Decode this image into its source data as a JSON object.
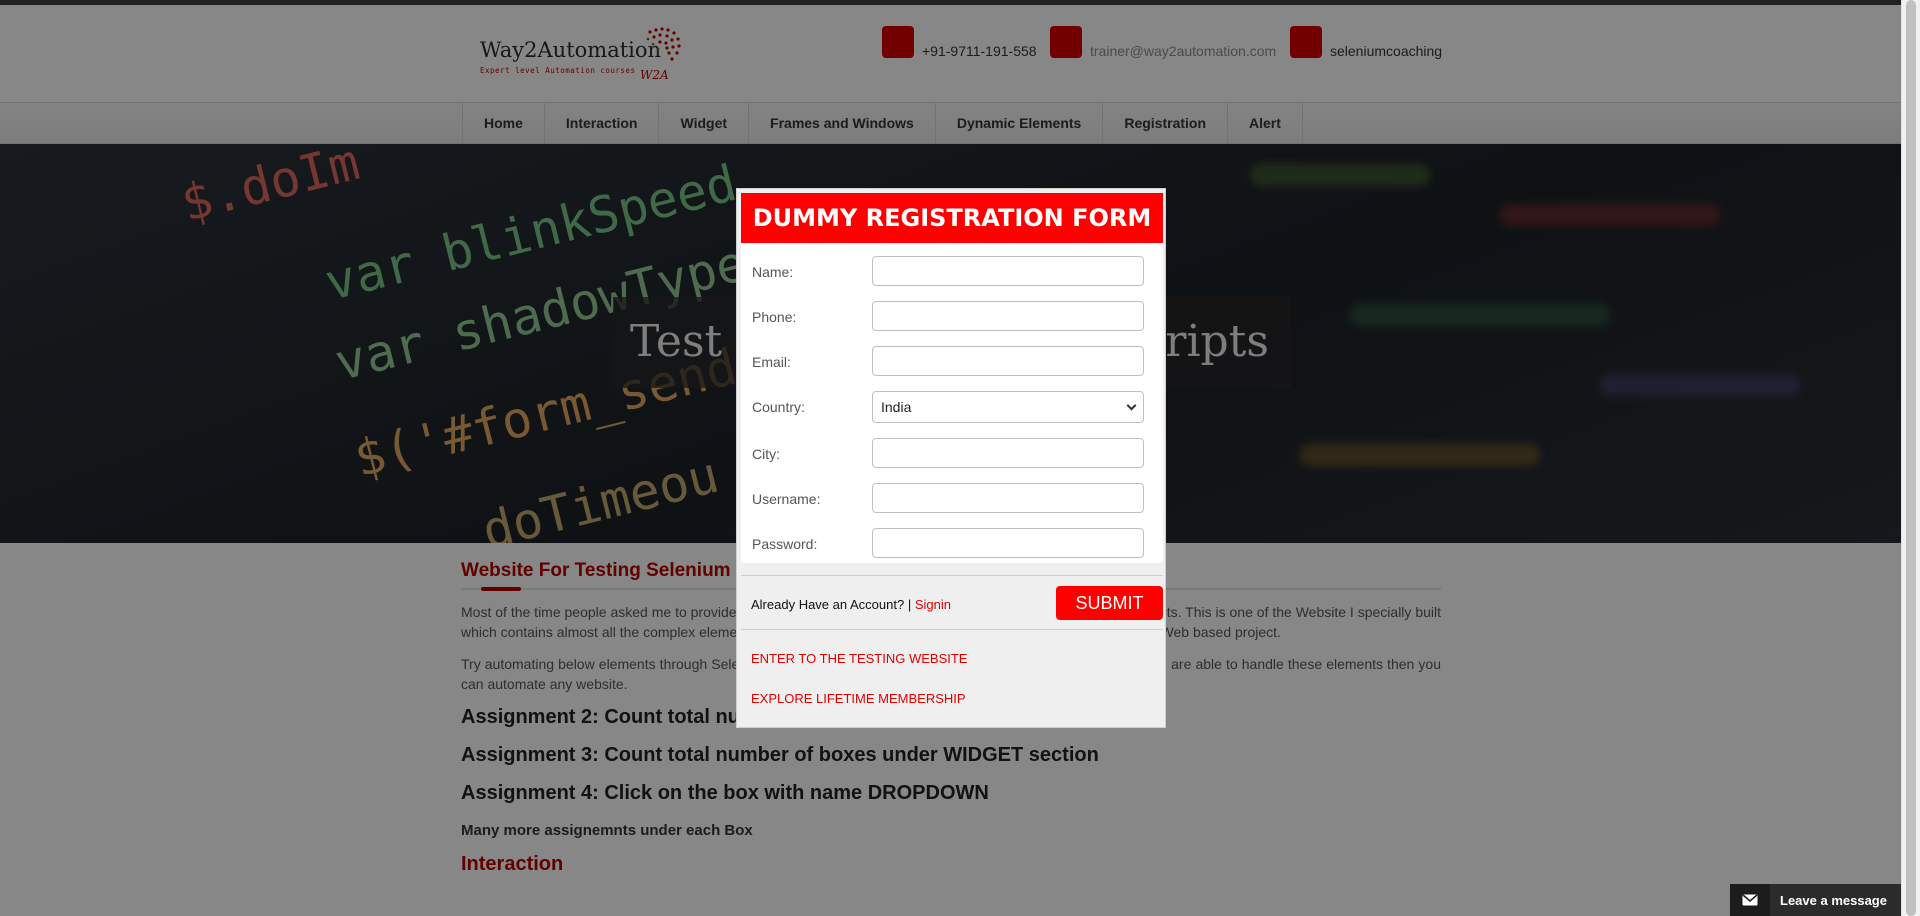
{
  "brand": {
    "name": "Way2Automation",
    "tagline": "Expert level Automation courses",
    "mark": "W2A"
  },
  "contacts": [
    {
      "icon": "phone-icon",
      "text": "+91-9711-191-558"
    },
    {
      "icon": "email-icon",
      "text": "trainer@way2automation.com"
    },
    {
      "icon": "skype-icon",
      "text": "seleniumcoaching"
    }
  ],
  "nav": [
    "Home",
    "Interaction",
    "Widget",
    "Frames and Windows",
    "Dynamic Elements",
    "Registration",
    "Alert"
  ],
  "hero": {
    "tagline": "Test your automation scripts",
    "code_lines": [
      "$.doIm",
      "var blinkSpeed",
      "var shadowType",
      "$('#form_send",
      "doTimeou"
    ]
  },
  "content": {
    "heading": "Website For Testing Selenium Scripts",
    "para1": "Most of the time people asked me to provide a website which they can use to practice their Selenium or QTP scripts. This is one of the Website I specially built which contains almost all the complex elements which we come across mostly while performing Automation on a Web based project.",
    "para2": "Try automating below elements through Selenium and you will be confident in executing automation scripts. If you are able to handle these elements then you can automate any website.",
    "assignments": [
      "Assignment 2: Count total number of boxes from below page",
      "Assignment 3: Count total number of boxes under WIDGET section",
      "Assignment 4: Click on the box with name DROPDOWN"
    ],
    "more": "Many more assignemnts under each Box",
    "section": "Interaction"
  },
  "modal": {
    "title": "DUMMY REGISTRATION FORM",
    "fields": {
      "name": {
        "label": "Name:",
        "value": ""
      },
      "phone": {
        "label": "Phone:",
        "value": ""
      },
      "email": {
        "label": "Email:",
        "value": ""
      },
      "country": {
        "label": "Country:",
        "value": "India"
      },
      "city": {
        "label": "City:",
        "value": ""
      },
      "username": {
        "label": "Username:",
        "value": ""
      },
      "password": {
        "label": "Password:",
        "value": ""
      }
    },
    "have_account": "Already Have an Account? |",
    "signin": "Signin",
    "submit": "SUBMIT",
    "link1": "ENTER TO THE TESTING WEBSITE",
    "link2": "EXPLORE LIFETIME MEMBERSHIP"
  },
  "chat": {
    "label": "Leave a message"
  },
  "colors": {
    "accent": "#ff0000",
    "brand_red": "#b30000",
    "nav_text": "#333333"
  }
}
